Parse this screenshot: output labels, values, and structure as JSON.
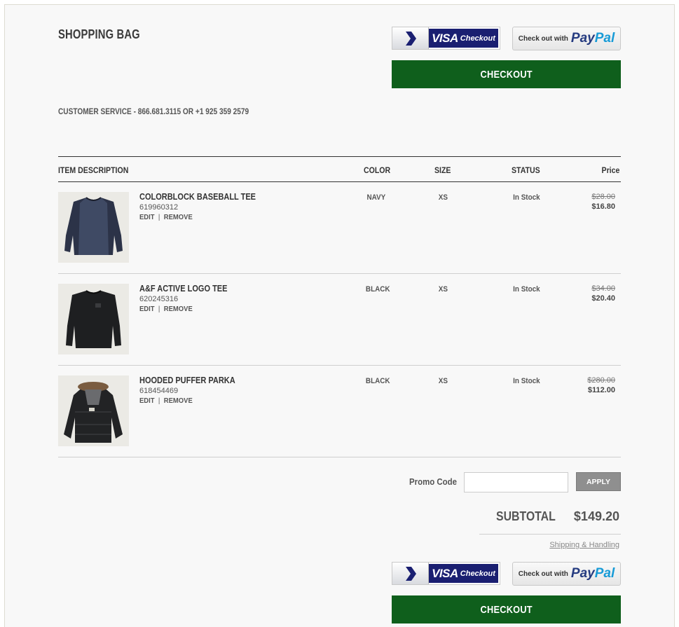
{
  "page": {
    "title": "SHOPPING BAG",
    "customer_service": "CUSTOMER SERVICE - 866.681.3115  OR  +1 925 359 2579"
  },
  "payment": {
    "visa_word": "VISA",
    "visa_checkout_word": "Checkout",
    "paypal_prefix": "Check out with",
    "paypal_pay": "Pay",
    "paypal_pal": "Pal",
    "checkout_label": "CHECKOUT"
  },
  "table": {
    "headers": {
      "item": "ITEM DESCRIPTION",
      "color": "COLOR",
      "size": "SIZE",
      "status": "STATUS",
      "price": "Price"
    },
    "edit_label": "EDIT",
    "separator": "|",
    "remove_label": "REMOVE",
    "items": [
      {
        "name": "COLORBLOCK BASEBALL TEE",
        "sku": "619960312",
        "color": "NAVY",
        "size": "XS",
        "status": "In Stock",
        "price_original": "$28.00",
        "price_sale": "$16.80",
        "thumb": "navy-raglan-tee-icon"
      },
      {
        "name": "A&F ACTIVE LOGO TEE",
        "sku": "620245316",
        "color": "BLACK",
        "size": "XS",
        "status": "In Stock",
        "price_original": "$34.00",
        "price_sale": "$20.40",
        "thumb": "black-long-sleeve-tee-icon"
      },
      {
        "name": "HOODED PUFFER PARKA",
        "sku": "618454469",
        "color": "BLACK",
        "size": "XS",
        "status": "In Stock",
        "price_original": "$280.00",
        "price_sale": "$112.00",
        "thumb": "black-puffer-parka-icon"
      }
    ]
  },
  "summary": {
    "promo_label": "Promo Code",
    "promo_value": "",
    "promo_placeholder": "",
    "apply_label": "APPLY",
    "subtotal_label": "SUBTOTAL",
    "subtotal_value": "$149.20",
    "shipping_link": "Shipping & Handling"
  },
  "colors": {
    "checkout_green": "#0f5f1c",
    "visa_navy": "#1a1f71",
    "paypal_dark": "#253b80",
    "paypal_light": "#179bd7",
    "apply_gray": "#8f8f8f"
  }
}
